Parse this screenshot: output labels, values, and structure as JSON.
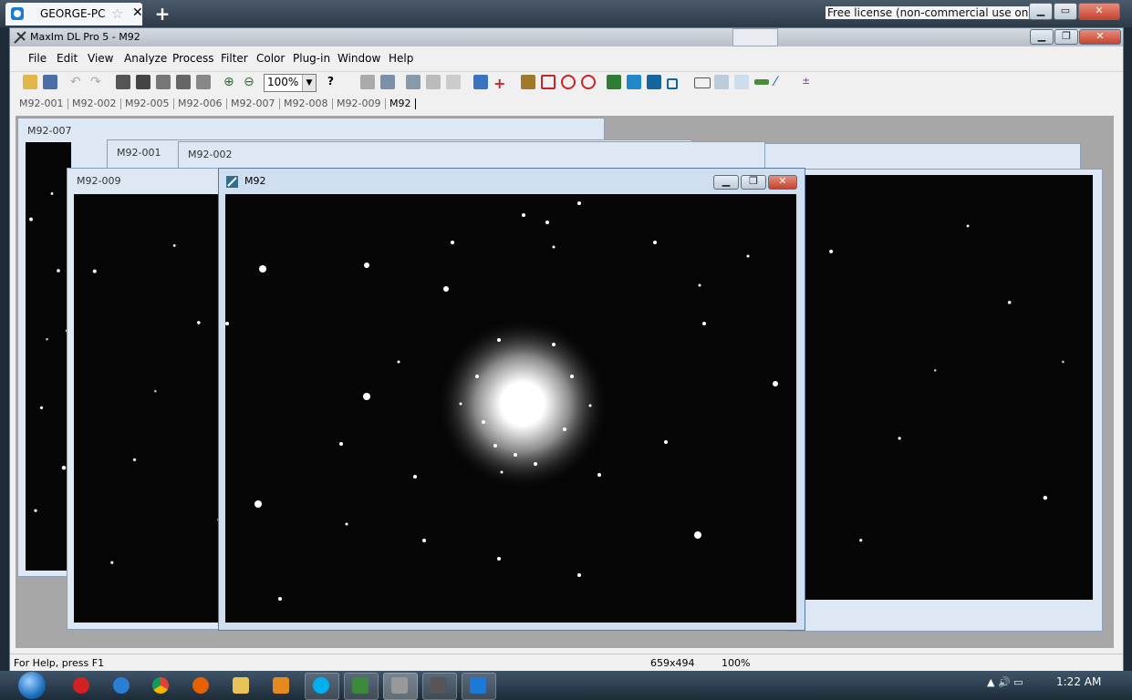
{
  "teamviewer": {
    "tab_title": "GEORGE-PC",
    "license_text": "Free license (non-commercial use only)"
  },
  "app": {
    "title": "MaxIm DL Pro 5 - M92",
    "menu": [
      "File",
      "Edit",
      "View",
      "Analyze",
      "Process",
      "Filter",
      "Color",
      "Plug-in",
      "Window",
      "Help"
    ],
    "zoom": "100%",
    "image_tabs": [
      "M92-001",
      "M92-002",
      "M92-005",
      "M92-006",
      "M92-007",
      "M92-008",
      "M92-009",
      "M92"
    ],
    "active_tab": "M92"
  },
  "windows": {
    "back1": "M92-007",
    "back2": "M92-001",
    "back3": "M92-002",
    "back4": "M92-009",
    "front": "M92"
  },
  "status": {
    "help": "For Help, press F1",
    "size": "659x494",
    "zoom": "100%"
  },
  "taskbar": {
    "time": "1:22 AM"
  },
  "colors": {
    "titlebar": "#dde8f4",
    "taskbar": "#2b3b4b",
    "close": "#c6432f"
  }
}
